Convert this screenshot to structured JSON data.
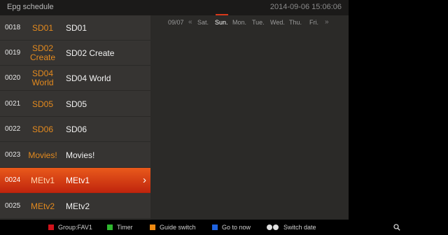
{
  "title": "Epg schedule",
  "datetime": "2014-09-06 15:06:06",
  "date_nav": {
    "date": "09/07",
    "prev_arrow": "«",
    "next_arrow": "»",
    "days": [
      "Sat.",
      "Sun.",
      "Mon.",
      "Tue.",
      "Wed.",
      "Thu.",
      "Fri."
    ],
    "active_day": "Sun."
  },
  "channels": [
    {
      "num": "0018",
      "short": "SD01",
      "name": "SD01"
    },
    {
      "num": "0019",
      "short": "SD02 Create",
      "name": "SD02 Create"
    },
    {
      "num": "0020",
      "short": "SD04 World",
      "name": "SD04 World"
    },
    {
      "num": "0021",
      "short": "SD05",
      "name": "SD05"
    },
    {
      "num": "0022",
      "short": "SD06",
      "name": "SD06"
    },
    {
      "num": "0023",
      "short": "Movies!",
      "name": "Movies!"
    },
    {
      "num": "0024",
      "short": "MEtv1",
      "name": "MEtv1",
      "selected": true,
      "chevron": "›"
    },
    {
      "num": "0025",
      "short": "MEtv2",
      "name": "MEtv2"
    }
  ],
  "footer": {
    "red": "Group:FAV1",
    "green": "Timer",
    "yellow": "Guide switch",
    "blue": "Go to now",
    "switch": "Switch date"
  },
  "colors": {
    "red": "#d0121b",
    "green": "#2fb82f",
    "yellow": "#ef8a12",
    "blue": "#1f63e0",
    "accent": "#e0451a"
  },
  "icons": {
    "search": "search-icon",
    "chevron": "chevron-right-icon",
    "switch": "left-right-circle-icons"
  }
}
